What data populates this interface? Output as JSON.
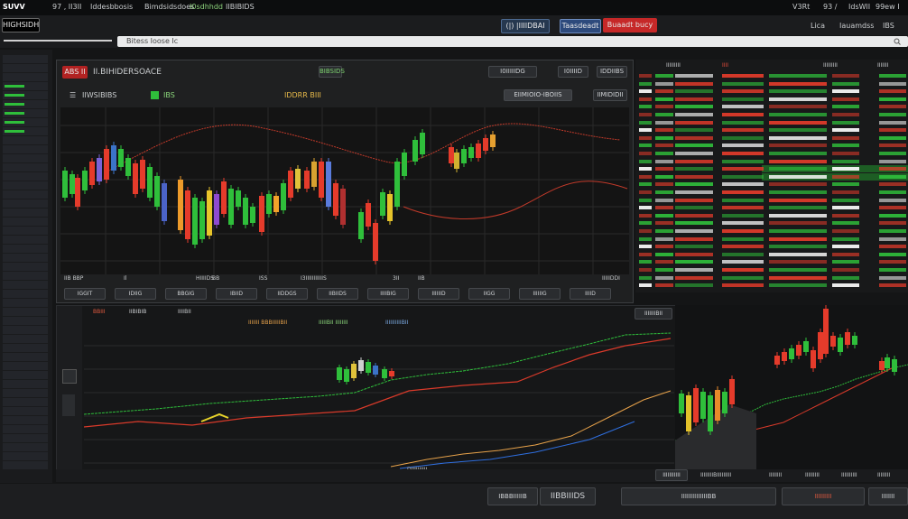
{
  "topbar": {
    "brand": "SUVV",
    "items": [
      "97 ,  II3II",
      "Iddesbbosis",
      "Bimdsidsdoes",
      "I0sdhhdd",
      "IIBIBIDS"
    ],
    "right_items": [
      "V3Rt",
      "93 / ",
      "IdsWlI",
      "99ew I"
    ]
  },
  "tabs": {
    "center": "(|) |IIIIDBAI",
    "center2": "Taasdeadt",
    "alert_button": "Buaadt bucy",
    "right_left": "Lica",
    "right_mid": "Iauamdss",
    "right_end": "IBS"
  },
  "address_bar": {
    "text": "Bitess  Ioose  Ic"
  },
  "app_title": "HIGHSIDH",
  "chart1": {
    "symbol_badge": "ABS  II",
    "title": "II.BIHIDERSOACE",
    "subtitle": "IIWSIBIBS",
    "indicator_tag": "BIBSIDS",
    "price_tag": "IDDRR BIII",
    "status_chip": "IBS",
    "btn_a": "I0IIIIIDG",
    "btn_b": "I0IIIID",
    "btn_c": "IDDIIBS",
    "btn_d": "EIIMIOIO-IBOIIS",
    "btn_e": "IIMIDIDII",
    "stats": [
      "IIB  BBP",
      "Il",
      "HIIIIDS",
      "BB",
      "ISS",
      "I3IIIIIIIIIIIS",
      "3II",
      "IIB",
      "IIIIIDDI"
    ],
    "tools": [
      "IGGIT",
      "IDIIG",
      "BBGIG",
      "IBIID",
      "IIDDGS",
      "IIBIIDS",
      "IIIIBIG",
      "IIIIIID",
      "IIGG",
      "IIIIIIG",
      "IIIID"
    ]
  },
  "chart2": {
    "header_left": "BBIII",
    "header_a": "IIBIBIB",
    "header_b": "IIIIBII",
    "legend": [
      "IIIIIII BBBIIIIIBII",
      "IIIIIBII IIIIIIII",
      "IIIIIIIIIIBII"
    ],
    "corner_chip": "IIIIIIIBII",
    "bottom_tag": "DIIIIIIIIII",
    "time_chip": "IIIIIIIIIII"
  },
  "watchlist": {
    "header": [
      "IIIIIIIII",
      "IIII",
      "IIIIIIIII",
      "IIIIIII"
    ],
    "rows": 28
  },
  "bottom_bar": {
    "btn1": "IBBBIIIIIB",
    "btn2": "IIBBIIIDS",
    "btn3": "IIIIIIIIIIIIIIBB",
    "btn4": "IIIIIIIII",
    "btn5": "IIIIIII",
    "row_labels": [
      "IIIIIIIIBIIIIIIIII",
      "IIIIIIII",
      "IIIIIIIII",
      "IIIIIIIIII",
      "IIIIIIII"
    ]
  },
  "colors": {
    "up": "#2fbf3b",
    "down": "#e53b2b",
    "accent_red": "#c22a2a",
    "accent_blue": "#2f4f82"
  },
  "icons": [
    "search-icon",
    "menu-icon",
    "close-icon",
    "expand-icon"
  ]
}
